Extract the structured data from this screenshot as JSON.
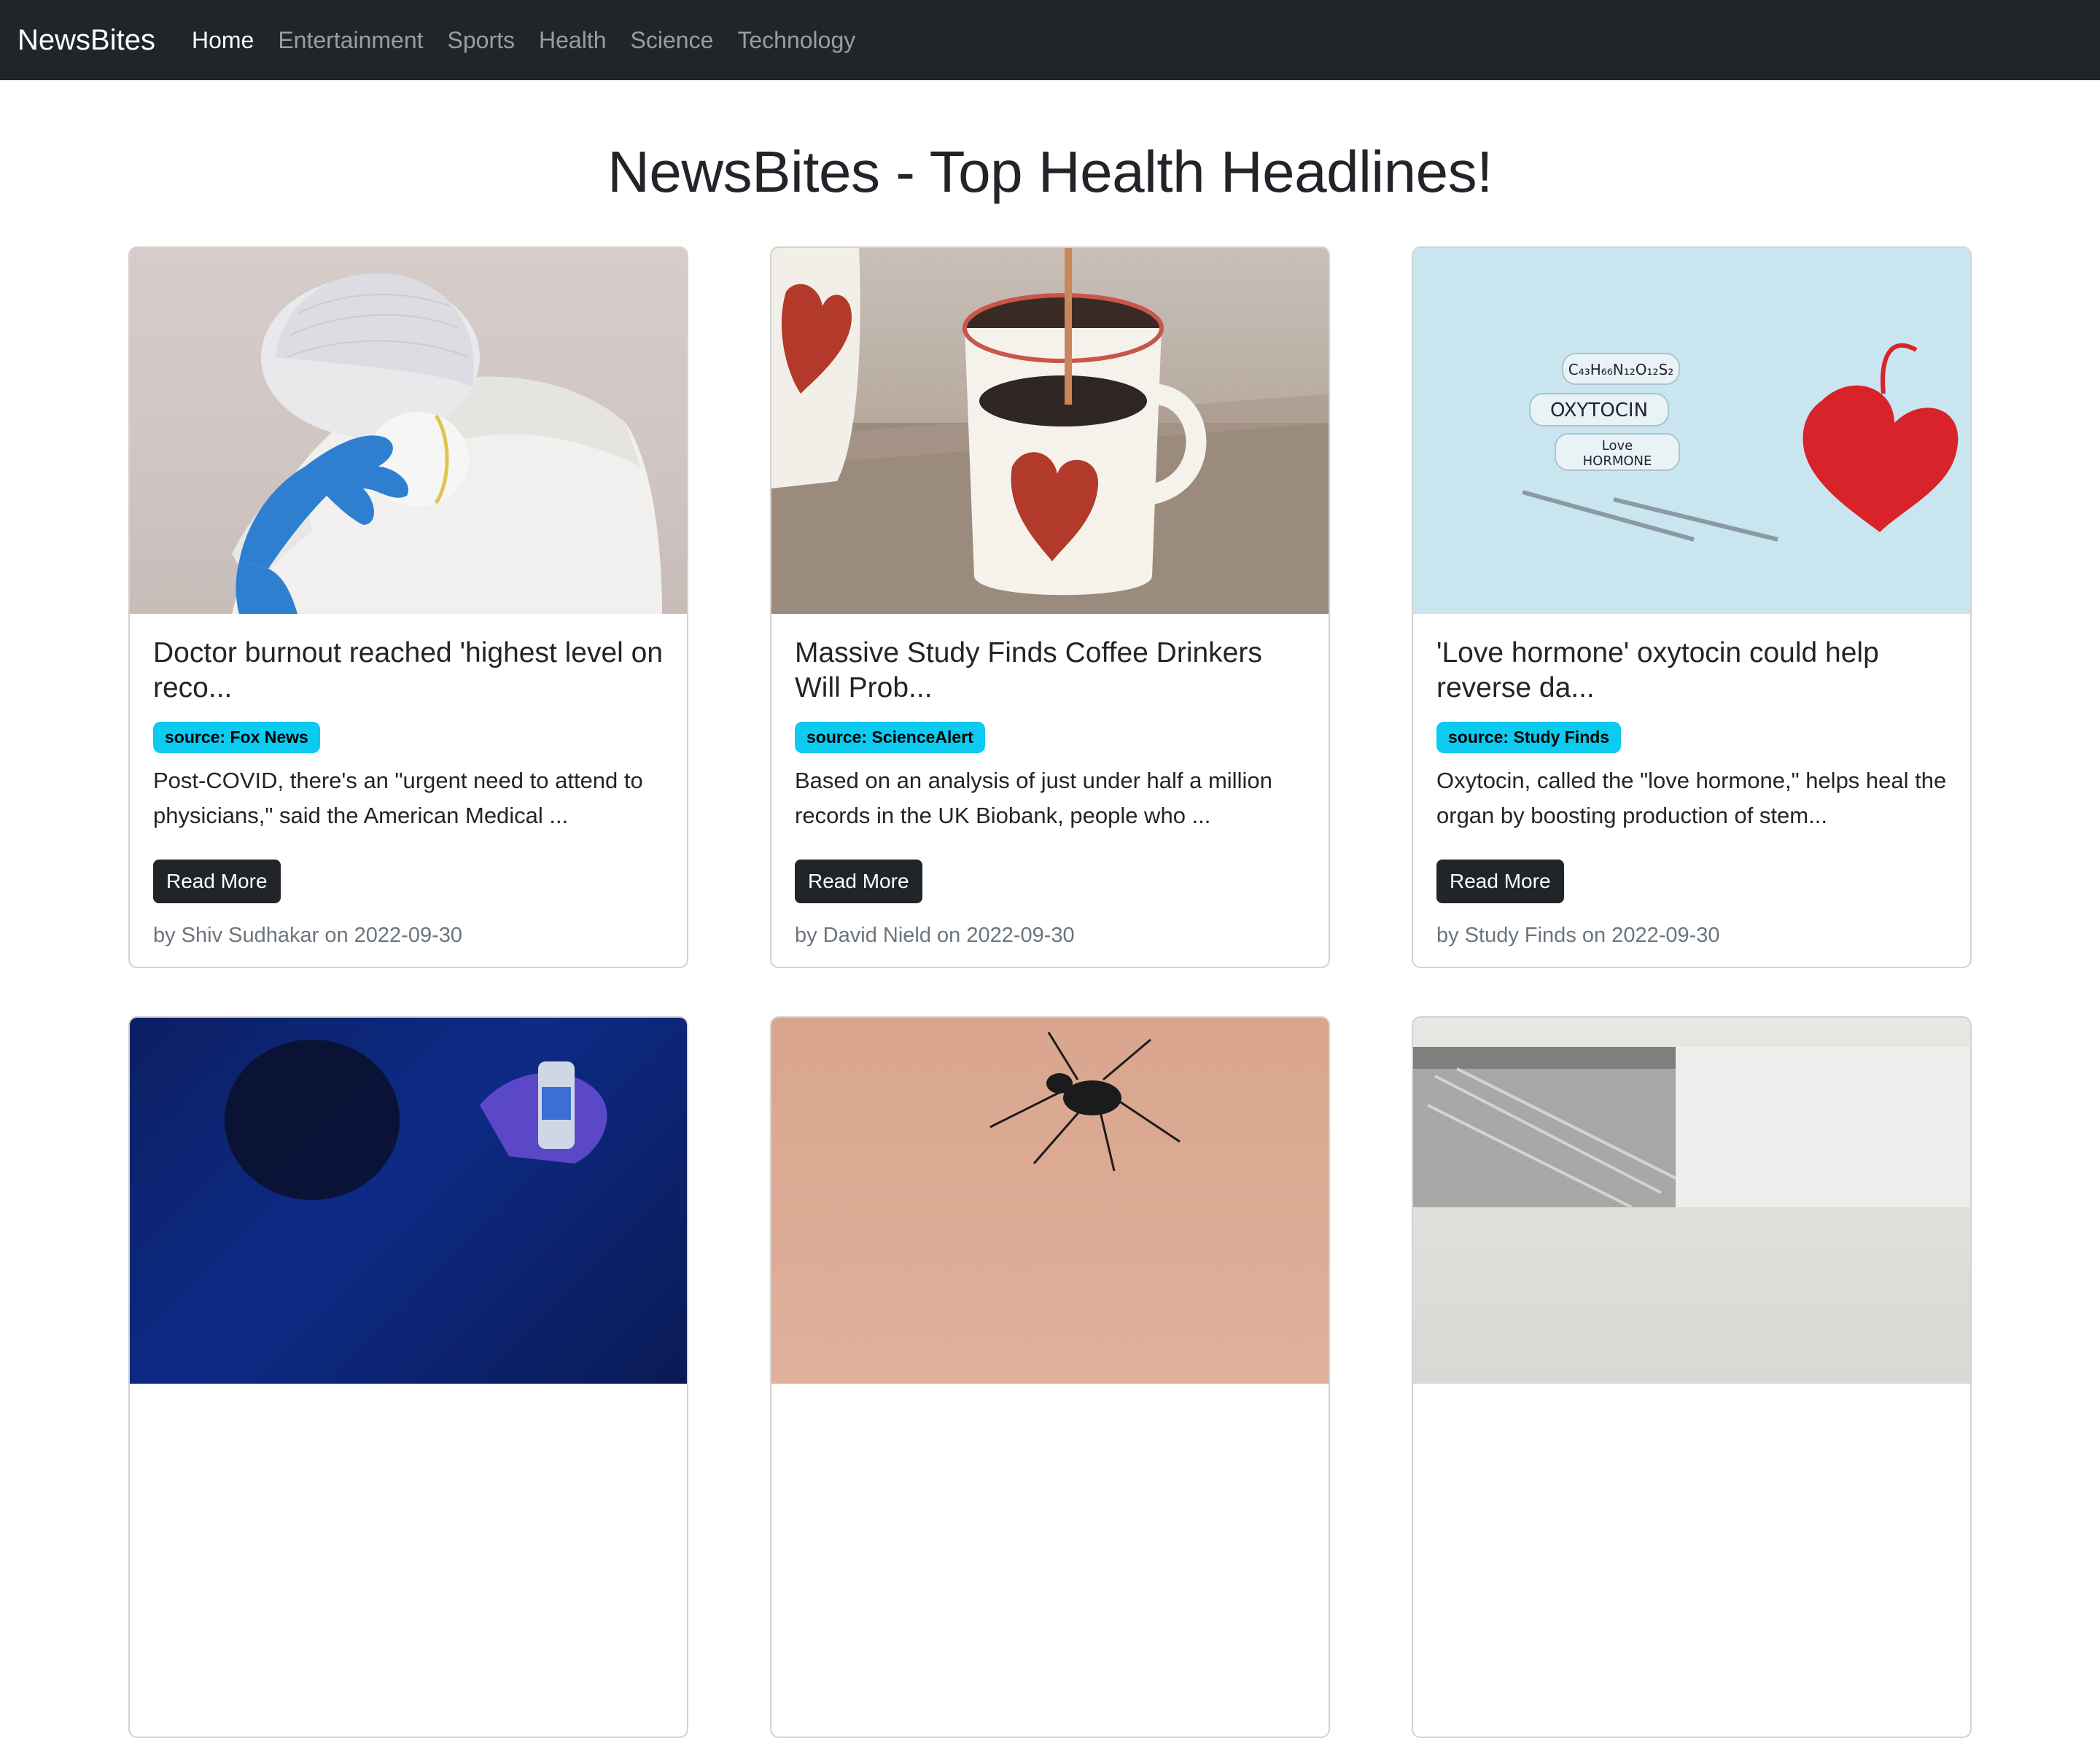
{
  "nav": {
    "brand": "NewsBites",
    "links": [
      "Home",
      "Entertainment",
      "Sports",
      "Health",
      "Science",
      "Technology"
    ],
    "active_index": 0
  },
  "page": {
    "title": "NewsBites - Top Health Headlines!"
  },
  "articles": [
    {
      "title": "Doctor burnout reached 'highest level on reco...",
      "source": "source: Fox News",
      "description": "Post-COVID, there's an \"urgent need to attend to physicians,\" said the American Medical ...",
      "button": "Read More",
      "meta": "by Shiv Sudhakar on 2022-09-30"
    },
    {
      "title": "Massive Study Finds Coffee Drinkers Will Prob...",
      "source": "source: ScienceAlert",
      "description": "Based on an analysis of just under half a million records in the UK Biobank, people who ...",
      "button": "Read More",
      "meta": "by David Nield on 2022-09-30"
    },
    {
      "title": "'Love hormone' oxytocin could help reverse da...",
      "source": "source: Study Finds",
      "description": "Oxytocin, called the \"love hormone,\" helps heal the organ by boosting production of stem...",
      "button": "Read More",
      "meta": "by Study Finds on 2022-09-30",
      "image_labels": [
        "C₄₃H₆₆N₁₂O₁₂S₂",
        "OXYTOCIN",
        "Love",
        "HORMONE"
      ]
    }
  ],
  "colors": {
    "navbar": "#212529",
    "badge": "#0dcaf0",
    "button": "#212529",
    "meta": "#6c757d"
  }
}
